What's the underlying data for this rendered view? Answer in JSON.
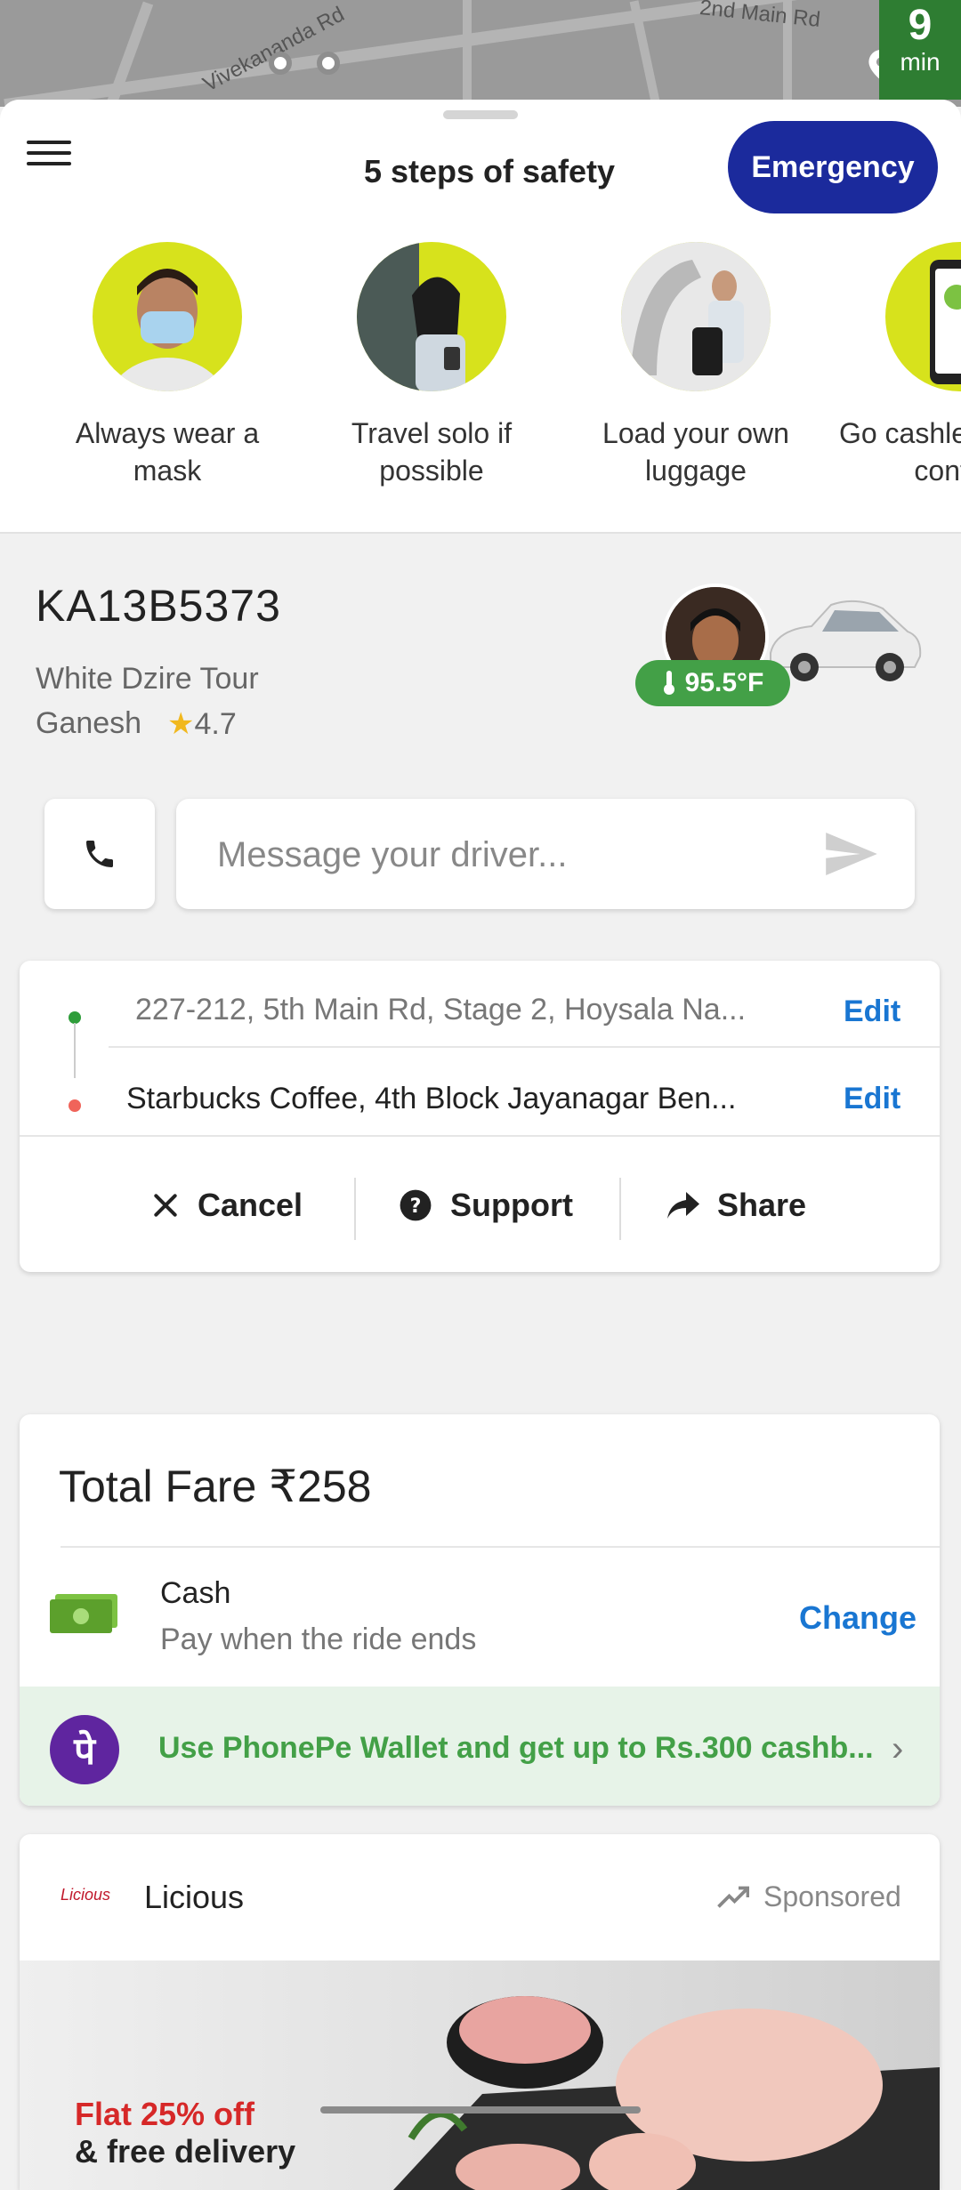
{
  "map": {
    "street_1": "Vivekananda Rd",
    "street_2": "2nd Main Rd",
    "eta_value": "9",
    "eta_unit": "min"
  },
  "safety": {
    "title": "5 steps of safety",
    "emergency_label": "Emergency",
    "tips": [
      {
        "caption": "Always wear a mask"
      },
      {
        "caption": "Travel solo if possible"
      },
      {
        "caption": "Load your own luggage"
      },
      {
        "caption": "Go cashless & limit contact"
      }
    ]
  },
  "ride": {
    "plate": "KA13B5373",
    "car_model": "White Dzire Tour",
    "driver_name": "Ganesh",
    "rating": "4.7",
    "temperature": "95.5°F",
    "message_placeholder": "Message your driver..."
  },
  "route": {
    "pickup": "227-212, 5th Main Rd, Stage 2, Hoysala Na...",
    "drop": "Starbucks Coffee, 4th Block Jayanagar Ben...",
    "edit_label": "Edit",
    "cancel_label": "Cancel",
    "support_label": "Support",
    "share_label": "Share",
    "pickup_color": "#2e9d3a",
    "drop_color": "#f0645a"
  },
  "fare": {
    "total_label": "Total Fare ₹258",
    "payment_method": "Cash",
    "payment_sub": "Pay when the ride ends",
    "change_label": "Change",
    "promo_text": "Use PhonePe Wallet and get up to Rs.300 cashb...",
    "phonepe_glyph": "पे"
  },
  "ad": {
    "logo_text": "Licious",
    "brand": "Licious",
    "sponsored_label": "Sponsored",
    "offer_line1": "Flat 25% off",
    "offer_line2": "& free delivery"
  }
}
